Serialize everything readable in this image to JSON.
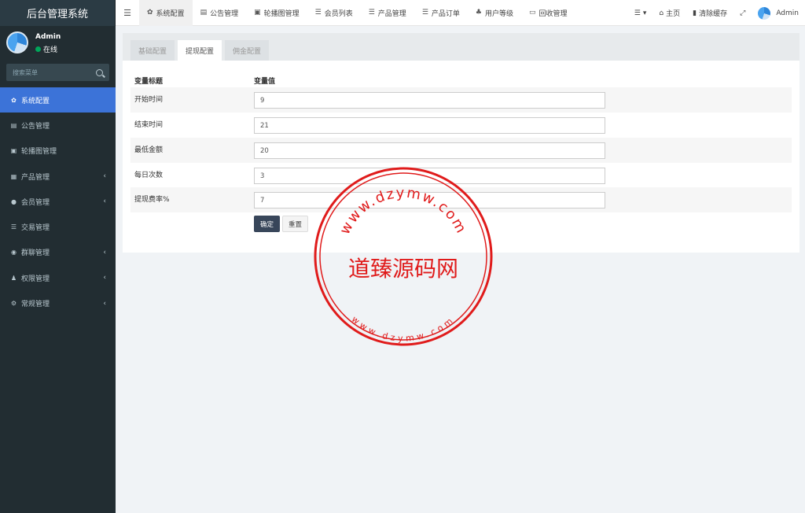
{
  "app": {
    "title": "后台管理系统"
  },
  "user": {
    "name": "Admin",
    "status": "在线"
  },
  "sidebar_search": {
    "placeholder": "搜索菜单"
  },
  "sidebar": {
    "items": [
      {
        "label": "系统配置",
        "icon": "gear-icon",
        "active": true,
        "has_children": false
      },
      {
        "label": "公告管理",
        "icon": "document-icon",
        "has_children": false
      },
      {
        "label": "轮播图管理",
        "icon": "image-icon",
        "has_children": false
      },
      {
        "label": "产品管理",
        "icon": "grid-icon",
        "has_children": true
      },
      {
        "label": "会员管理",
        "icon": "user-icon",
        "has_children": true
      },
      {
        "label": "交易管理",
        "icon": "list-icon",
        "has_children": false
      },
      {
        "label": "群聊管理",
        "icon": "chat-icon",
        "has_children": true
      },
      {
        "label": "权限管理",
        "icon": "users-icon",
        "has_children": true
      },
      {
        "label": "常规管理",
        "icon": "cogs-icon",
        "has_children": true
      }
    ]
  },
  "topbar": {
    "tabs": [
      {
        "label": "系统配置",
        "icon": "gear-icon",
        "active": true
      },
      {
        "label": "公告管理",
        "icon": "document-icon"
      },
      {
        "label": "轮播图管理",
        "icon": "image-icon"
      },
      {
        "label": "会员列表",
        "icon": "list-icon"
      },
      {
        "label": "产品管理",
        "icon": "list-icon"
      },
      {
        "label": "产品订单",
        "icon": "list-icon"
      },
      {
        "label": "用户等级",
        "icon": "sitemap-icon"
      },
      {
        "label": "回收管理",
        "icon": "card-icon"
      }
    ],
    "home_label": "主页",
    "clear_cache_label": "清除缓存",
    "user_label": "Admin"
  },
  "subtabs": [
    {
      "label": "基础配置",
      "active": false
    },
    {
      "label": "提现配置",
      "active": true
    },
    {
      "label": "佣金配置",
      "active": false
    }
  ],
  "config": {
    "header_title": "变量标题",
    "header_value": "变量值",
    "rows": [
      {
        "label": "开始时间",
        "value": "9"
      },
      {
        "label": "结束时间",
        "value": "21"
      },
      {
        "label": "最低金额",
        "value": "20"
      },
      {
        "label": "每日次数",
        "value": "3"
      },
      {
        "label": "提现费率%",
        "value": "7"
      }
    ],
    "confirm_label": "确定",
    "reset_label": "重置"
  },
  "watermark": {
    "center_text": "道臻源码网",
    "ring_text": "www.dzymw.com",
    "color": "#e01b1b"
  }
}
